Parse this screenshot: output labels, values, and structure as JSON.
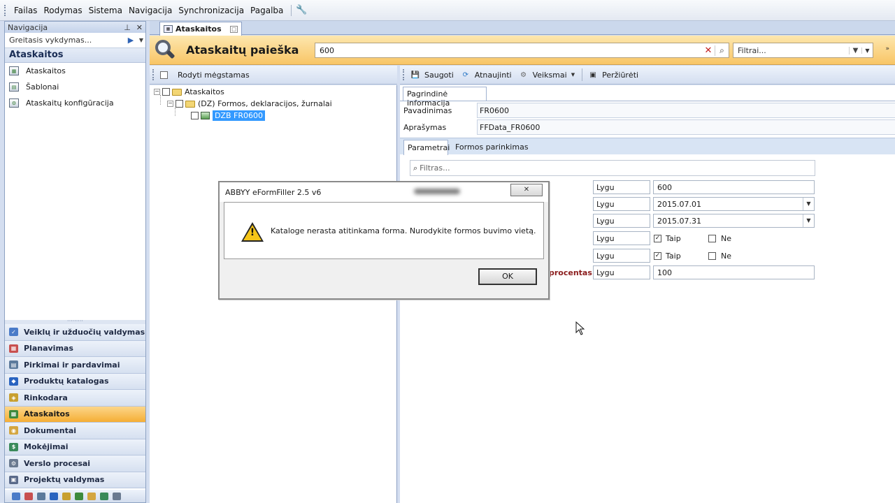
{
  "menu": [
    "Failas",
    "Rodymas",
    "Sistema",
    "Navigacija",
    "Synchronizacija",
    "Pagalba"
  ],
  "nav": {
    "title": "Navigacija",
    "quick_placeholder": "Greitasis vykdymas...",
    "section": "Ataskaitos",
    "items": [
      "Ataskaitos",
      "Šablonai",
      "Ataskaitų konfigūracija"
    ],
    "groups": [
      "Veiklų ir užduočių valdymas",
      "Planavimas",
      "Pirkimai ir pardavimai",
      "Produktų katalogas",
      "Rinkodara",
      "Ataskaitos",
      "Dokumentai",
      "Mokėjimai",
      "Verslo procesai",
      "Projektų valdymas"
    ],
    "active_group": "Ataskaitos"
  },
  "doc_tab": "Ataskaitos",
  "search": {
    "title": "Ataskaitų paieška",
    "query": "600",
    "filter_placeholder": "Filtrai..."
  },
  "tree_toolbar": {
    "show_favorites": "Rodyti mėgstamas"
  },
  "tree": {
    "root": "Ataskaitos",
    "folder": "(DZ) Formos, deklaracijos, žurnalai",
    "leaf": "DZB FR0600"
  },
  "detail_toolbar": {
    "save": "Saugoti",
    "refresh": "Atnaujinti",
    "actions": "Veiksmai",
    "preview": "Peržiūrėti"
  },
  "detail": {
    "main_tab": "Pagrindinė informacija",
    "name_label": "Pavadinimas",
    "name_value": "FR0600",
    "desc_label": "Aprašymas",
    "desc_value": "FFData_FR0600",
    "sub_tabs": [
      "Parametrai",
      "Formos parinkimas"
    ],
    "filter_placeholder": "Filtras...",
    "params": [
      {
        "op": "Lygu",
        "value": "600"
      },
      {
        "op": "Lygu",
        "value": "2015.07.01"
      },
      {
        "op": "Lygu",
        "value": "2015.07.31"
      },
      {
        "op": "Lygu",
        "yes": "Taip",
        "no": "Ne"
      },
      {
        "op": "Lygu",
        "yes": "Taip",
        "no": "Ne"
      },
      {
        "op": "Lygu",
        "value": "100",
        "label": "procentas"
      }
    ]
  },
  "dialog": {
    "title": "ABBYY eFormFiller 2.5 v6",
    "message": "Kataloge nerasta atitinkama forma. Nurodykite formos buvimo vietą.",
    "ok": "OK",
    "close_glyph": "✕"
  }
}
